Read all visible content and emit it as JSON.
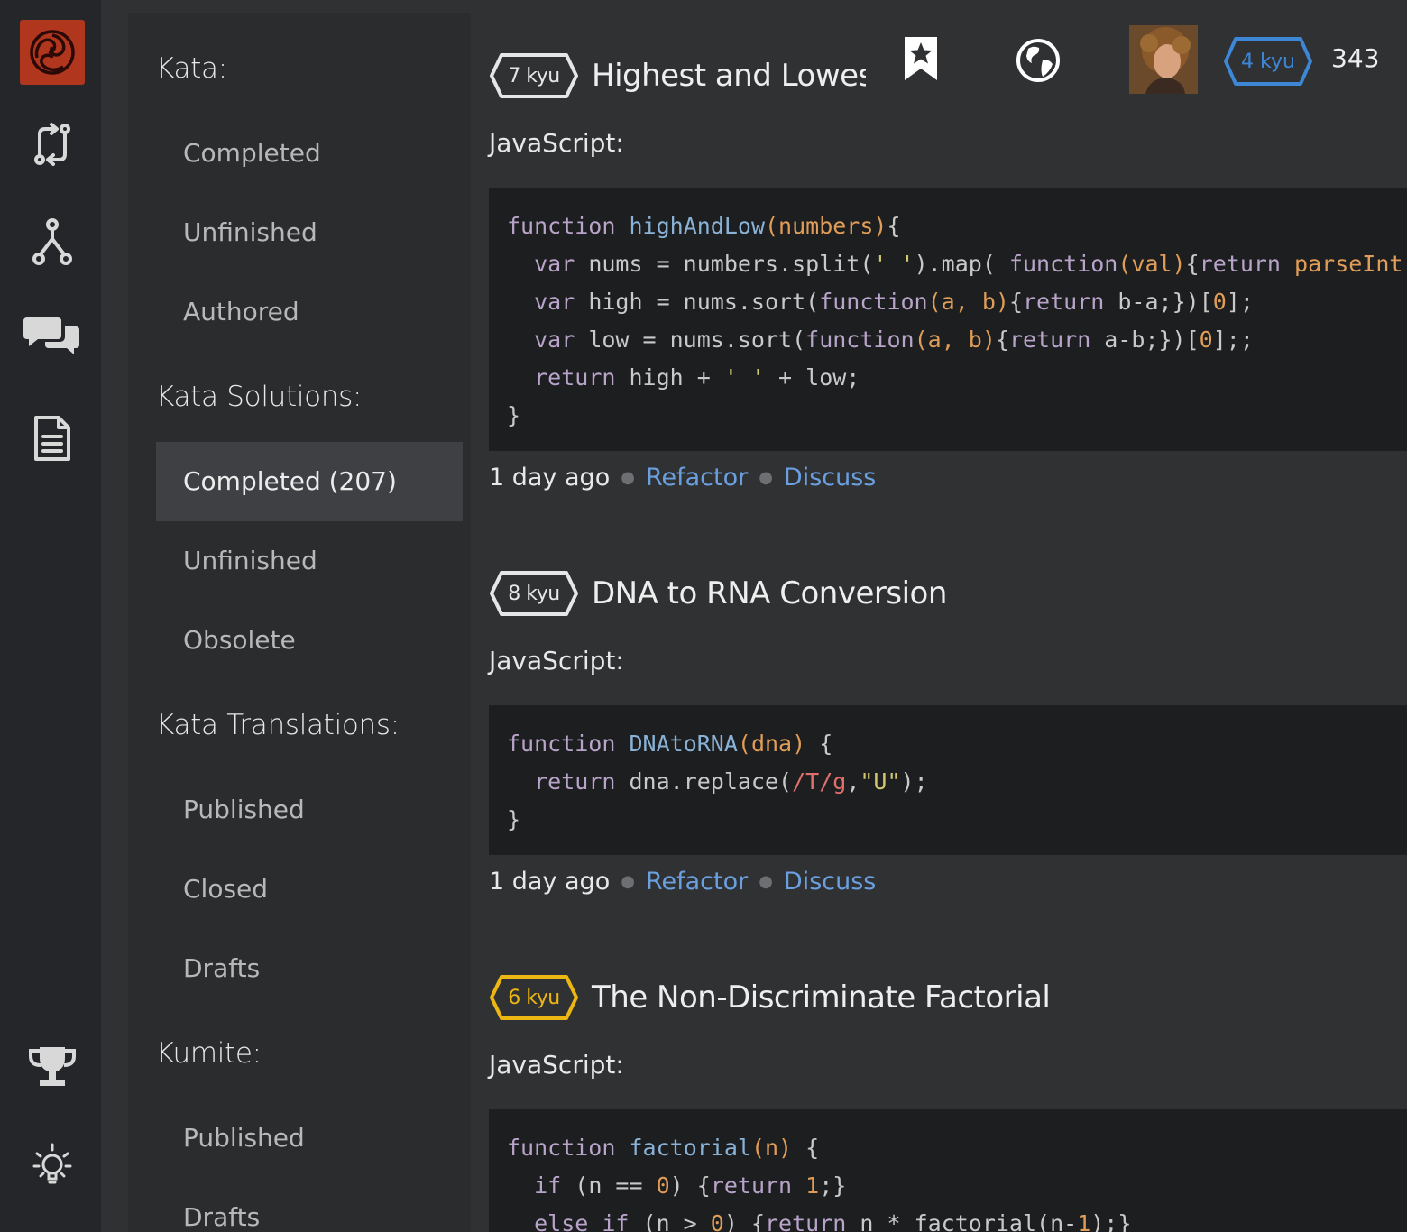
{
  "rail": {
    "icons": [
      "codewars-logo",
      "practice-icon",
      "fork-icon",
      "discussion-icon",
      "docs-icon",
      "trophy-icon",
      "lightbulb-icon"
    ]
  },
  "nav": {
    "kata_heading": "Kata:",
    "kata_items": [
      "Completed",
      "Unfinished",
      "Authored"
    ],
    "solutions_heading": "Kata Solutions:",
    "solutions_items": [
      "Completed (207)",
      "Unfinished",
      "Obsolete"
    ],
    "translations_heading": "Kata Translations:",
    "translations_items": [
      "Published",
      "Closed",
      "Drafts"
    ],
    "kumite_heading": "Kumite:",
    "kumite_items": [
      "Published",
      "Drafts"
    ]
  },
  "header": {
    "rank": "4 kyu",
    "honor": "343",
    "rank_color": "#3e86d6"
  },
  "katas": [
    {
      "rank": "7 kyu",
      "rank_color": "#e6e6e6",
      "title": "Highest and Lowest",
      "language": "JavaScript:",
      "time": "1 day ago",
      "refactor": "Refactor",
      "discuss": "Discuss"
    },
    {
      "rank": "8 kyu",
      "rank_color": "#e6e6e6",
      "title": "DNA to RNA Conversion",
      "language": "JavaScript:",
      "time": "1 day ago",
      "refactor": "Refactor",
      "discuss": "Discuss"
    },
    {
      "rank": "6 kyu",
      "rank_color": "#ecb613",
      "title": "The Non-Discriminate Factorial",
      "language": "JavaScript:"
    }
  ],
  "code": {
    "k1": [
      "function highAndLow(numbers){",
      "  var nums = numbers.split(' ').map( function(val){return parseInt(val",
      "  var high = nums.sort(function(a, b){return b-a;})[0];",
      "  var low = nums.sort(function(a, b){return a-b;})[0];;",
      "  return high + ' ' + low;",
      "}"
    ],
    "k2": [
      "function DNAtoRNA(dna) {",
      "  return dna.replace(/T/g,\"U\");",
      "}"
    ],
    "k3": [
      "function factorial(n) {",
      "  if (n == 0) {return 1;}",
      "  else if (n > 0) {return n * factorial(n-1);}"
    ]
  }
}
